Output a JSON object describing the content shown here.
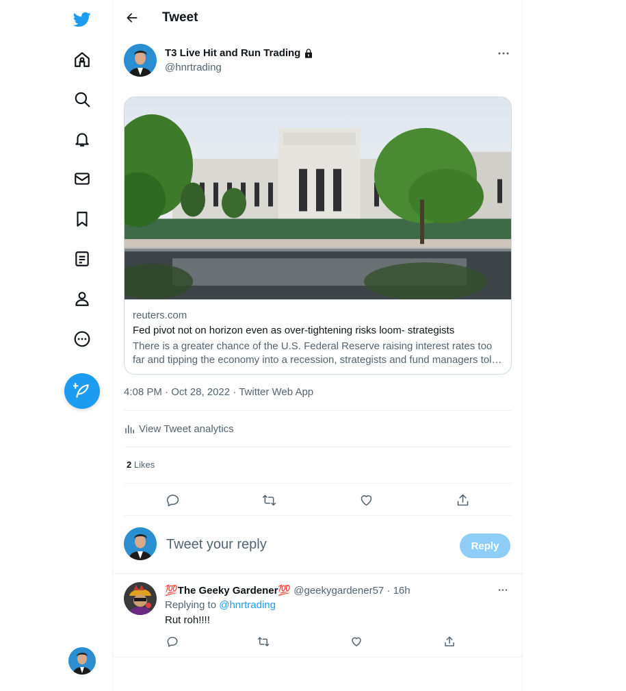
{
  "nav": {
    "items": [
      {
        "name": "twitter-logo-icon"
      },
      {
        "name": "home-icon"
      },
      {
        "name": "search-icon"
      },
      {
        "name": "notifications-icon"
      },
      {
        "name": "messages-icon"
      },
      {
        "name": "bookmarks-icon"
      },
      {
        "name": "lists-icon"
      },
      {
        "name": "profile-icon"
      },
      {
        "name": "more-icon"
      }
    ],
    "compose_icon": "compose-feather-icon"
  },
  "header": {
    "back_icon": "arrow-left-icon",
    "title": "Tweet"
  },
  "tweet": {
    "author_name": "T3 Live Hit and Run Trading",
    "locked_icon": "lock-icon",
    "author_handle": "@hnrtrading",
    "card": {
      "image_icon": "federal-reserve-building-photo",
      "domain": "reuters.com",
      "title": "Fed pivot not on horizon even as over-tightening risks loom- strategists",
      "description_line1": "There is a greater chance of the U.S. Federal Reserve raising interest rates too",
      "description_line2": "far and tipping the economy into a recession, strategists and fund managers tol…"
    },
    "time": "4:08 PM",
    "separator": " · ",
    "date": "Oct 28, 2022",
    "source": "Twitter Web App",
    "analytics_label": "View Tweet analytics",
    "likes_count": "2",
    "likes_label": " Likes"
  },
  "reply_composer": {
    "placeholder": "Tweet your reply",
    "button_label": "Reply"
  },
  "replies": [
    {
      "name": "💯The Geeky Gardener💯",
      "handle": "@geekygardener57",
      "dot": " · ",
      "time": "16h",
      "replying_prefix": "Replying to ",
      "replying_handle": "@hnrtrading",
      "text": "Rut roh!!!!"
    }
  ],
  "colors": {
    "accent": "#1d9bf0",
    "reply_button_disabled": "#8ecdf8",
    "text_primary": "#0f1419",
    "text_secondary": "#536471",
    "border": "#eff3f4"
  }
}
